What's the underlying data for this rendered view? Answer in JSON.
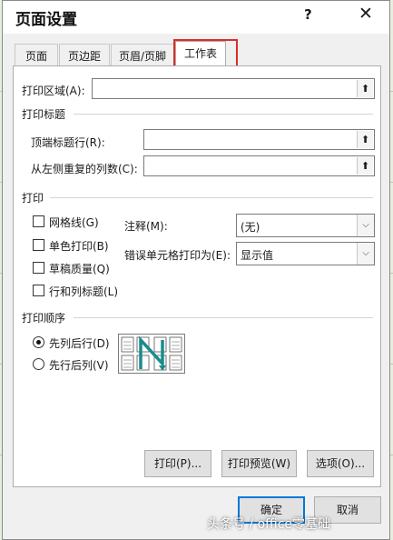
{
  "dialog": {
    "title": "页面设置",
    "help_label": "?",
    "close_label": "✕"
  },
  "tabs": [
    {
      "label": "页面"
    },
    {
      "label": "页边距"
    },
    {
      "label": "页眉/页脚"
    },
    {
      "label": "工作表",
      "active": true
    }
  ],
  "sheet": {
    "print_area_label": "打印区域(A):",
    "print_area_value": "",
    "print_titles_section": "打印标题",
    "rows_repeat_label": "顶端标题行(R):",
    "rows_repeat_value": "",
    "cols_repeat_label": "从左侧重复的列数(C):",
    "cols_repeat_value": "",
    "print_section": "打印",
    "checkboxes": [
      {
        "label": "网格线(G)",
        "checked": false
      },
      {
        "label": "单色打印(B)",
        "checked": false
      },
      {
        "label": "草稿质量(Q)",
        "checked": false
      },
      {
        "label": "行和列标题(L)",
        "checked": false
      }
    ],
    "comments_label": "注释(M):",
    "comments_value": "(无)",
    "errors_label": "错误单元格打印为(E):",
    "errors_value": "显示值",
    "order_section": "打印顺序",
    "order_options": [
      {
        "label": "先列后行(D)",
        "selected": true
      },
      {
        "label": "先行后列(V)",
        "selected": false
      }
    ]
  },
  "buttons": {
    "print": "打印(P)...",
    "print_preview": "打印预览(W)",
    "options": "选项(O)...",
    "ok": "确定",
    "cancel": "取消"
  },
  "watermark": "头条号 / office零基础",
  "colors": {
    "highlight": "#e02a2a",
    "default_button_border": "#0078d7",
    "order_arrow": "#1a8c8c"
  }
}
